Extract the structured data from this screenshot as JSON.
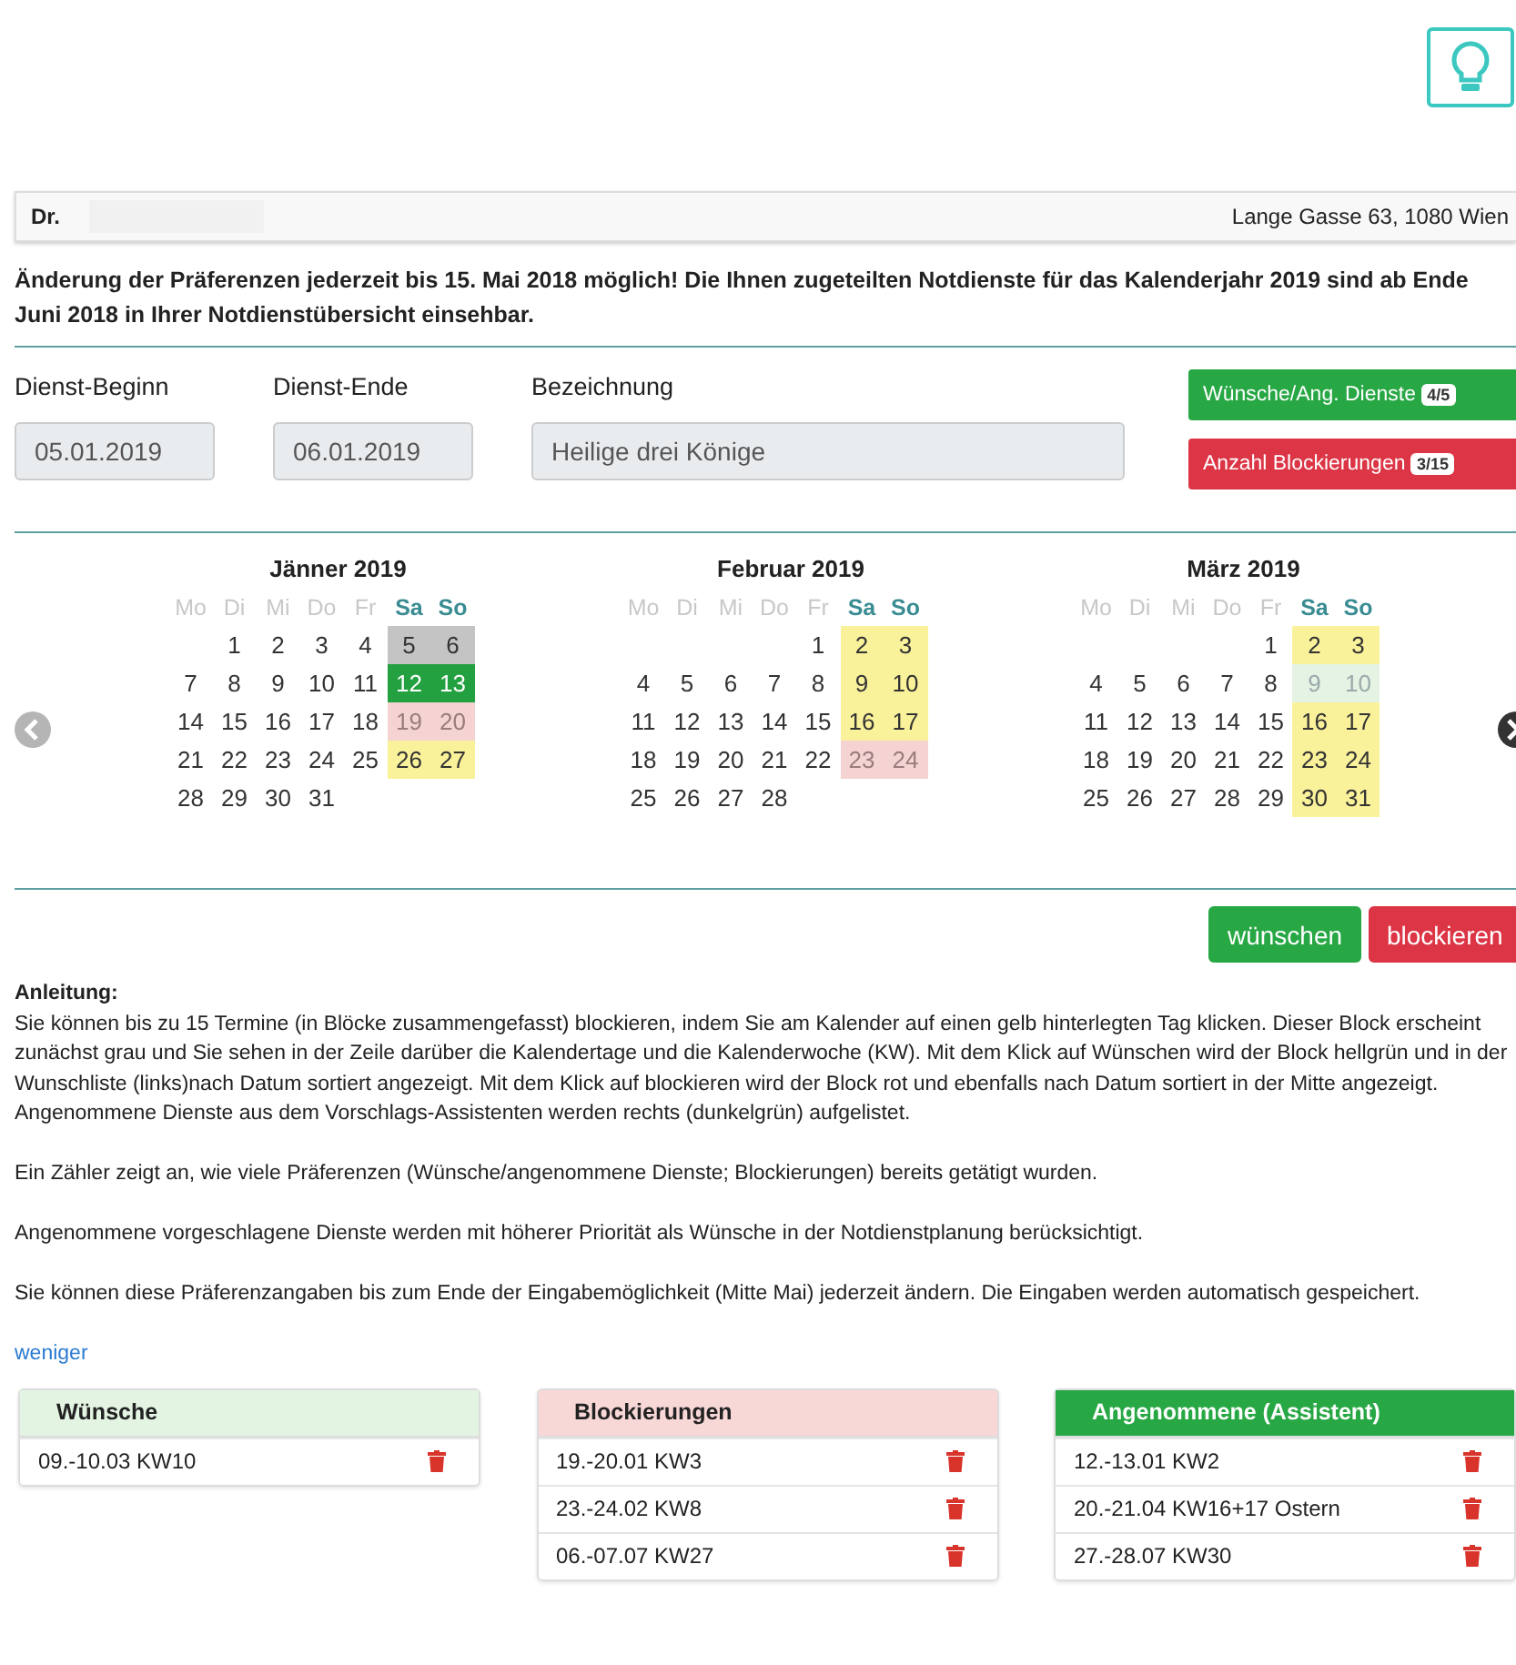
{
  "header": {
    "doctor": "Dr.",
    "address": "Lange Gasse 63, 1080 Wien"
  },
  "notice": "Änderung der Präferenzen jederzeit bis 15. Mai 2018 möglich! Die Ihnen zugeteilten Notdienste für das Kalenderjahr 2019 sind ab Ende Juni 2018 in Ihrer Notdienstübersicht einsehbar.",
  "fields": [
    {
      "label": "Dienst-Beginn",
      "value": "05.01.2019",
      "kind": "short"
    },
    {
      "label": "Dienst-Ende",
      "value": "06.01.2019",
      "kind": "short"
    },
    {
      "label": "Bezeichnung",
      "value": "Heilige drei Könige",
      "kind": "wide"
    }
  ],
  "counters": [
    {
      "label": "Wünsche/Ang. Dienste",
      "badge": "4/5",
      "kind": "success"
    },
    {
      "label": "Anzahl Blockierungen",
      "badge": "3/15",
      "kind": "danger"
    }
  ],
  "months": [
    {
      "title": "Jänner 2019",
      "weekdays": [
        {
          "label": "Mo",
          "weekend": false
        },
        {
          "label": "Di",
          "weekend": false
        },
        {
          "label": "Mi",
          "weekend": false
        },
        {
          "label": "Do",
          "weekend": false
        },
        {
          "label": "Fr",
          "weekend": false
        },
        {
          "label": "Sa",
          "weekend": true
        },
        {
          "label": "So",
          "weekend": true
        }
      ],
      "weeks": [
        [
          {
            "kind": "blank"
          },
          {
            "day": "1",
            "kind": "plain"
          },
          {
            "day": "2",
            "kind": "plain"
          },
          {
            "day": "3",
            "kind": "plain"
          },
          {
            "day": "4",
            "kind": "plain"
          },
          {
            "day": "5",
            "kind": "selected"
          },
          {
            "day": "6",
            "kind": "selected"
          }
        ],
        [
          {
            "day": "7",
            "kind": "plain"
          },
          {
            "day": "8",
            "kind": "plain"
          },
          {
            "day": "9",
            "kind": "plain"
          },
          {
            "day": "10",
            "kind": "plain"
          },
          {
            "day": "11",
            "kind": "plain"
          },
          {
            "day": "12",
            "kind": "accepted"
          },
          {
            "day": "13",
            "kind": "accepted"
          }
        ],
        [
          {
            "day": "14",
            "kind": "plain"
          },
          {
            "day": "15",
            "kind": "plain"
          },
          {
            "day": "16",
            "kind": "plain"
          },
          {
            "day": "17",
            "kind": "plain"
          },
          {
            "day": "18",
            "kind": "plain"
          },
          {
            "day": "19",
            "kind": "blocked"
          },
          {
            "day": "20",
            "kind": "blocked"
          }
        ],
        [
          {
            "day": "21",
            "kind": "plain"
          },
          {
            "day": "22",
            "kind": "plain"
          },
          {
            "day": "23",
            "kind": "plain"
          },
          {
            "day": "24",
            "kind": "plain"
          },
          {
            "day": "25",
            "kind": "plain"
          },
          {
            "day": "26",
            "kind": "available"
          },
          {
            "day": "27",
            "kind": "available"
          }
        ],
        [
          {
            "day": "28",
            "kind": "plain"
          },
          {
            "day": "29",
            "kind": "plain"
          },
          {
            "day": "30",
            "kind": "plain"
          },
          {
            "day": "31",
            "kind": "plain"
          }
        ]
      ]
    },
    {
      "title": "Februar 2019",
      "weekdays": [
        {
          "label": "Mo",
          "weekend": false
        },
        {
          "label": "Di",
          "weekend": false
        },
        {
          "label": "Mi",
          "weekend": false
        },
        {
          "label": "Do",
          "weekend": false
        },
        {
          "label": "Fr",
          "weekend": false
        },
        {
          "label": "Sa",
          "weekend": true
        },
        {
          "label": "So",
          "weekend": true
        }
      ],
      "weeks": [
        [
          {
            "kind": "blank"
          },
          {
            "kind": "blank"
          },
          {
            "kind": "blank"
          },
          {
            "kind": "blank"
          },
          {
            "day": "1",
            "kind": "plain"
          },
          {
            "day": "2",
            "kind": "available"
          },
          {
            "day": "3",
            "kind": "available"
          }
        ],
        [
          {
            "day": "4",
            "kind": "plain"
          },
          {
            "day": "5",
            "kind": "plain"
          },
          {
            "day": "6",
            "kind": "plain"
          },
          {
            "day": "7",
            "kind": "plain"
          },
          {
            "day": "8",
            "kind": "plain"
          },
          {
            "day": "9",
            "kind": "available"
          },
          {
            "day": "10",
            "kind": "available"
          }
        ],
        [
          {
            "day": "11",
            "kind": "plain"
          },
          {
            "day": "12",
            "kind": "plain"
          },
          {
            "day": "13",
            "kind": "plain"
          },
          {
            "day": "14",
            "kind": "plain"
          },
          {
            "day": "15",
            "kind": "plain"
          },
          {
            "day": "16",
            "kind": "available"
          },
          {
            "day": "17",
            "kind": "available"
          }
        ],
        [
          {
            "day": "18",
            "kind": "plain"
          },
          {
            "day": "19",
            "kind": "plain"
          },
          {
            "day": "20",
            "kind": "plain"
          },
          {
            "day": "21",
            "kind": "plain"
          },
          {
            "day": "22",
            "kind": "plain"
          },
          {
            "day": "23",
            "kind": "blocked"
          },
          {
            "day": "24",
            "kind": "blocked"
          }
        ],
        [
          {
            "day": "25",
            "kind": "plain"
          },
          {
            "day": "26",
            "kind": "plain"
          },
          {
            "day": "27",
            "kind": "plain"
          },
          {
            "day": "28",
            "kind": "plain"
          }
        ]
      ]
    },
    {
      "title": "März 2019",
      "weekdays": [
        {
          "label": "Mo",
          "weekend": false
        },
        {
          "label": "Di",
          "weekend": false
        },
        {
          "label": "Mi",
          "weekend": false
        },
        {
          "label": "Do",
          "weekend": false
        },
        {
          "label": "Fr",
          "weekend": false
        },
        {
          "label": "Sa",
          "weekend": true
        },
        {
          "label": "So",
          "weekend": true
        }
      ],
      "weeks": [
        [
          {
            "kind": "blank"
          },
          {
            "kind": "blank"
          },
          {
            "kind": "blank"
          },
          {
            "kind": "blank"
          },
          {
            "day": "1",
            "kind": "plain"
          },
          {
            "day": "2",
            "kind": "available"
          },
          {
            "day": "3",
            "kind": "available"
          }
        ],
        [
          {
            "day": "4",
            "kind": "plain"
          },
          {
            "day": "5",
            "kind": "plain"
          },
          {
            "day": "6",
            "kind": "plain"
          },
          {
            "day": "7",
            "kind": "plain"
          },
          {
            "day": "8",
            "kind": "plain"
          },
          {
            "day": "9",
            "kind": "wish"
          },
          {
            "day": "10",
            "kind": "wish"
          }
        ],
        [
          {
            "day": "11",
            "kind": "plain"
          },
          {
            "day": "12",
            "kind": "plain"
          },
          {
            "day": "13",
            "kind": "plain"
          },
          {
            "day": "14",
            "kind": "plain"
          },
          {
            "day": "15",
            "kind": "plain"
          },
          {
            "day": "16",
            "kind": "available"
          },
          {
            "day": "17",
            "kind": "available"
          }
        ],
        [
          {
            "day": "18",
            "kind": "plain"
          },
          {
            "day": "19",
            "kind": "plain"
          },
          {
            "day": "20",
            "kind": "plain"
          },
          {
            "day": "21",
            "kind": "plain"
          },
          {
            "day": "22",
            "kind": "plain"
          },
          {
            "day": "23",
            "kind": "available"
          },
          {
            "day": "24",
            "kind": "available"
          }
        ],
        [
          {
            "day": "25",
            "kind": "plain"
          },
          {
            "day": "26",
            "kind": "plain"
          },
          {
            "day": "27",
            "kind": "plain"
          },
          {
            "day": "28",
            "kind": "plain"
          },
          {
            "day": "29",
            "kind": "plain"
          },
          {
            "day": "30",
            "kind": "available"
          },
          {
            "day": "31",
            "kind": "available"
          }
        ]
      ]
    }
  ],
  "actions": [
    {
      "label": "wünschen",
      "kind": "success"
    },
    {
      "label": "blockieren",
      "kind": "danger"
    }
  ],
  "instructions": {
    "title": "Anleitung:",
    "groups": [
      [
        "Sie können bis zu 15 Termine (in Blöcke zusammengefasst) blockieren, indem Sie am Kalender auf einen gelb hinterlegten Tag klicken. Dieser Block erscheint zunächst grau und Sie sehen in der Zeile darüber die Kalendertage und die Kalenderwoche (KW). Mit dem Klick auf Wünschen wird der Block hellgrün und in der Wunschliste (links)nach Datum sortiert angezeigt. Mit dem Klick auf blockieren wird der Block rot und ebenfalls nach Datum sortiert in der Mitte angezeigt.",
        "Angenommene Dienste aus dem Vorschlags-Assistenten werden rechts (dunkelgrün) aufgelistet."
      ],
      [
        "Ein Zähler zeigt an, wie viele Präferenzen (Wünsche/angenommene Dienste; Blockierungen) bereits getätigt wurden."
      ],
      [
        "Angenommene vorgeschlagene Dienste werden mit höherer Priorität als Wünsche in der Notdienstplanung berücksichtigt."
      ],
      [
        "Sie können diese Präferenzangaben bis zum Ende der Eingabemöglichkeit (Mitte Mai) jederzeit ändern. Die Eingaben werden automatisch gespeichert."
      ]
    ],
    "toggle": "weniger"
  },
  "panels": [
    {
      "title": "Wünsche",
      "kind": "wish",
      "items": [
        {
          "label": "09.-10.03 KW10"
        }
      ]
    },
    {
      "title": "Blockierungen",
      "kind": "blocked",
      "items": [
        {
          "label": "19.-20.01 KW3"
        },
        {
          "label": "23.-24.02 KW8"
        },
        {
          "label": "06.-07.07 KW27"
        }
      ]
    },
    {
      "title": "Angenommene (Assistent)",
      "kind": "accepted",
      "items": [
        {
          "label": "12.-13.01 KW2"
        },
        {
          "label": "20.-21.04 KW16+17 Ostern"
        },
        {
          "label": "27.-28.07 KW30"
        }
      ]
    }
  ]
}
